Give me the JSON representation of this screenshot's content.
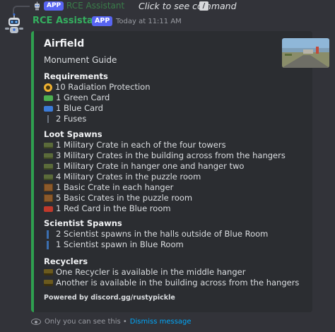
{
  "reply": {
    "app_badge": "APP",
    "author": "RCE Assistant",
    "command_text": "Click to see command",
    "command_icon": "slash-command-icon"
  },
  "message": {
    "author": "RCE Assistant",
    "app_badge": "APP",
    "timestamp": "Today at 11:11 AM",
    "avatar_icon": "robot-avatar-icon"
  },
  "embed": {
    "accent_color": "#2fa04f",
    "title": "Airfield",
    "description": "Monument Guide",
    "thumbnail_icon": "airfield-thumbnail-image",
    "sections": [
      {
        "title": "Requirements",
        "lines": [
          {
            "icon": "radiation-icon",
            "text": "10 Radiation Protection"
          },
          {
            "icon": "green-card-icon",
            "text": "1 Green Card"
          },
          {
            "icon": "blue-card-icon",
            "text": "1 Blue Card"
          },
          {
            "icon": "fuse-icon",
            "text": "2 Fuses"
          }
        ]
      },
      {
        "title": "Loot Spawns",
        "lines": [
          {
            "icon": "military-crate-icon",
            "text": "1 Military Crate in each of the four towers"
          },
          {
            "icon": "military-crate-icon",
            "text": "3 Military Crates in the building across from the hangers"
          },
          {
            "icon": "military-crate-icon",
            "text": "1 Military Crate in hanger one and hanger two"
          },
          {
            "icon": "military-crate-icon",
            "text": "4 Military Crates in the puzzle room"
          },
          {
            "icon": "basic-crate-icon",
            "text": "1 Basic Crate in each hanger"
          },
          {
            "icon": "basic-crate-icon",
            "text": "5 Basic Crates in the puzzle room"
          },
          {
            "icon": "red-card-icon",
            "text": "1 Red Card in the Blue room"
          }
        ]
      },
      {
        "title": "Scientist Spawns",
        "lines": [
          {
            "icon": "scientist-icon",
            "text": "2 Scientist spawns in the halls outside of Blue Room"
          },
          {
            "icon": "scientist-icon",
            "text": "1 Scientist spawn in Blue Room"
          }
        ]
      },
      {
        "title": "Recyclers",
        "lines": [
          {
            "icon": "recycler-icon",
            "text": "One Recycler is available in the middle hanger"
          },
          {
            "icon": "recycler-icon",
            "text": "Another is available in the building across from the hangers"
          }
        ]
      }
    ],
    "footer": "Powered by discord.gg/rustypickle"
  },
  "ephemeral": {
    "text": "Only you can see this •",
    "dismiss_label": "Dismiss message"
  }
}
